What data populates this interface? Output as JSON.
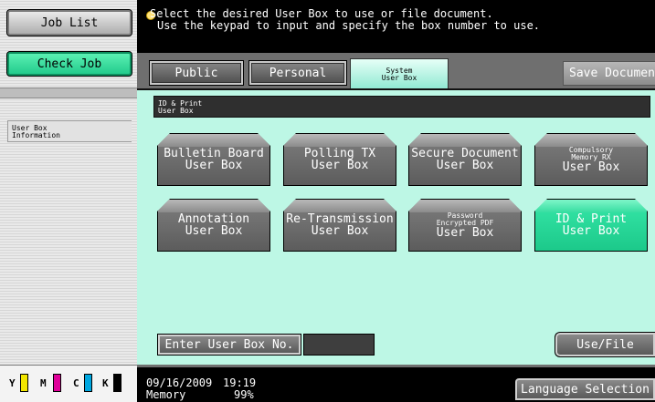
{
  "left_panel": {
    "job_list_label": "Job List",
    "check_job_label": "Check Job",
    "info_tab_line1": "User Box",
    "info_tab_line2": "Information",
    "toner": [
      {
        "letter": "Y",
        "color": "#f2e600"
      },
      {
        "letter": "M",
        "color": "#e0009a"
      },
      {
        "letter": "C",
        "color": "#00a7e0"
      },
      {
        "letter": "K",
        "color": "#000000"
      }
    ]
  },
  "message": {
    "line1": "Select the desired User Box to use or file document.",
    "line2": "Use the keypad to input and specify the box number to use.",
    "icon": "lightbulb-icon"
  },
  "tabs": {
    "public": "Public",
    "personal": "Personal",
    "system_line1": "System",
    "system_line2": "User Box",
    "save_document": "Save Document"
  },
  "breadcrumb": {
    "line1": "ID & Print",
    "line2": "User Box"
  },
  "boxes": [
    {
      "l1": "Bulletin Board",
      "l2": "User Box",
      "small": false,
      "selected": false
    },
    {
      "l1": "Polling TX",
      "l2": "User Box",
      "small": false,
      "selected": false
    },
    {
      "l1": "Secure Document",
      "l2": "User Box",
      "small": false,
      "selected": false
    },
    {
      "l1": "Compulsory",
      "l1b": "Memory RX",
      "l2": "User Box",
      "small": true,
      "selected": false
    },
    {
      "l1": "Annotation",
      "l2": "User Box",
      "small": false,
      "selected": false
    },
    {
      "l1": "Re-Transmission",
      "l2": "User Box",
      "small": false,
      "selected": false
    },
    {
      "l1": "Password",
      "l1b": "Encrypted PDF",
      "l2": "User Box",
      "small": true,
      "selected": false
    },
    {
      "l1": "ID & Print",
      "l2": "User Box",
      "small": false,
      "selected": true
    }
  ],
  "bottom": {
    "enter_box_label": "Enter User Box No.",
    "entry_value": "",
    "use_file_label": "Use/File"
  },
  "status": {
    "date": "09/16/2009",
    "time": "19:19",
    "memory_label": "Memory",
    "memory_value": "99%",
    "language_label": "Language Selection"
  },
  "colors": {
    "accent_mint": "#bdf7e5",
    "selected_green": "#1ec889",
    "panel_gray": "#6f6f6f"
  }
}
